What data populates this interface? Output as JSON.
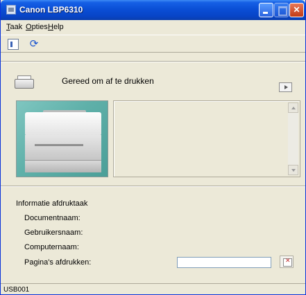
{
  "window": {
    "title": "Canon LBP6310"
  },
  "menu": {
    "items": [
      "Taak",
      "Opties",
      "Help"
    ]
  },
  "toolbar": {
    "icons": [
      "list-icon",
      "refresh-icon"
    ]
  },
  "status": {
    "message": "Gereed om af te drukken"
  },
  "info": {
    "title": "Informatie afdruktaak",
    "labels": [
      "Documentnaam:",
      "Gebruikersnaam:",
      "Computernaam:",
      "Pagina's afdrukken:"
    ],
    "pages_value": ""
  },
  "statusbar": {
    "port": "USB001"
  },
  "colors": {
    "titlebar": "#0a4fd6",
    "window_bg": "#ece9d8",
    "close_button": "#c23b14",
    "printer_bg": "#5fb0a9"
  }
}
